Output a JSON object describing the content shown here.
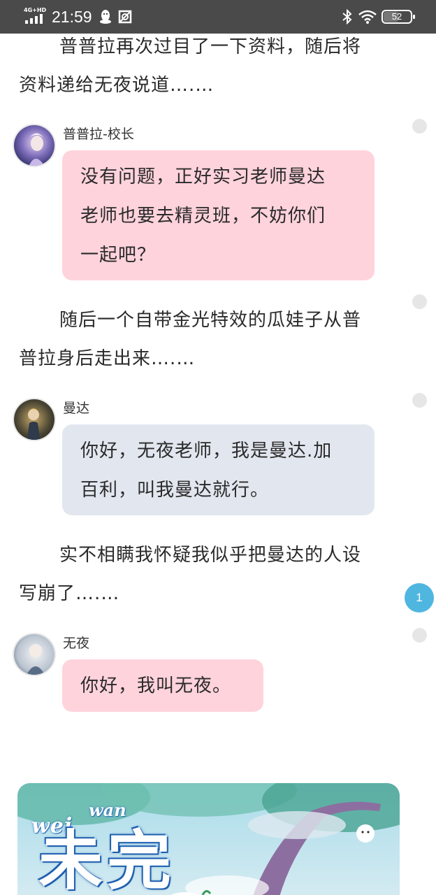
{
  "status_bar": {
    "network": "4G+HD",
    "time": "21:59",
    "battery": "52",
    "battery_level": 0.52,
    "icons": [
      "signal-icon",
      "qq-icon",
      "screenshot-icon",
      "bluetooth-icon",
      "wifi-icon",
      "battery-icon"
    ]
  },
  "story": {
    "narration_1": {
      "line1": "普普拉再次过目了一下资料，随后将",
      "line2": "资料递给无夜说道….…"
    },
    "message_1": {
      "sender": "普普拉-校长",
      "line1": "没有问题，正好实习老师曼达",
      "line2": "老师也要去精灵班，不妨你们",
      "line3": "一起吧？"
    },
    "narration_2": {
      "line1": "随后一个自带金光特效的瓜娃子从普",
      "line2": "普拉身后走出来….…"
    },
    "message_2": {
      "sender": "曼达",
      "line1": "你好，无夜老师，我是曼达.加",
      "line2": "百利，叫我曼达就行。"
    },
    "narration_3": {
      "line1": "实不相瞒我怀疑我似乎把曼达的人设",
      "line2": "写崩了….…"
    },
    "message_3": {
      "sender": "无夜",
      "line1": "你好，我叫无夜。"
    },
    "comment_badge": "1",
    "banner": {
      "title_pinyin_1": "wei",
      "title_pinyin_2": "wan",
      "title_chars": "未完"
    }
  },
  "colors": {
    "status_bar": "#4a4a4a",
    "pink_bubble": "#ffd3dc",
    "gray_bubble": "#e2e7ef",
    "badge": "#4fb6e0"
  }
}
